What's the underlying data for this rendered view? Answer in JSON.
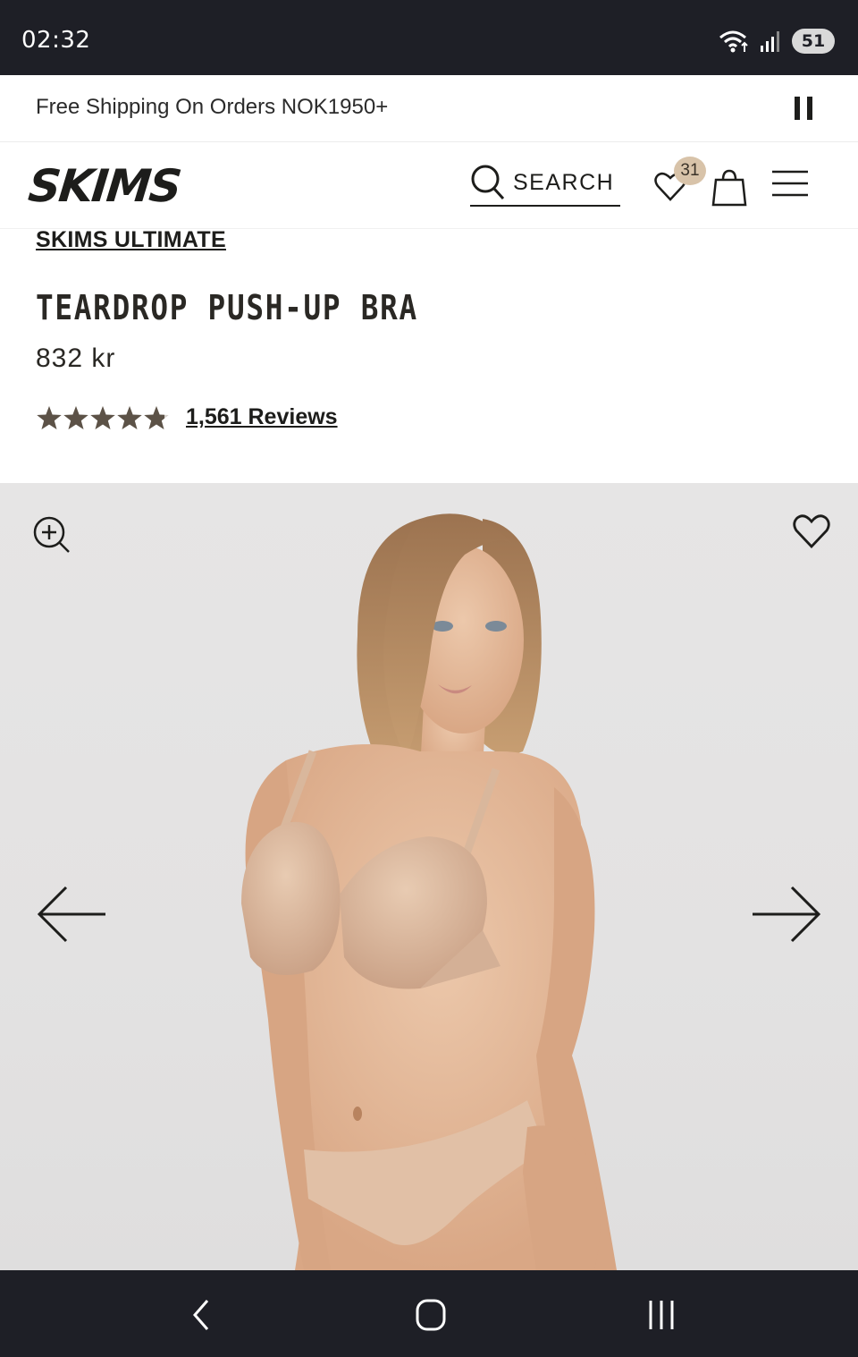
{
  "status_bar": {
    "time": "02:32",
    "battery": "51",
    "icons": [
      "wifi-icon",
      "signal-icon",
      "battery-icon"
    ]
  },
  "promo": {
    "text": "Free Shipping On Orders NOK1950+",
    "pause_icon": "pause-icon"
  },
  "header": {
    "logo": "SKIMS",
    "search_label": "SEARCH",
    "wishlist_count": "31",
    "icons": [
      "search-icon",
      "heart-icon",
      "bag-icon",
      "menu-icon"
    ]
  },
  "product": {
    "collection": "SKIMS ULTIMATE",
    "title": "TEARDROP PUSH-UP BRA",
    "price": "832 kr",
    "rating": 4.8,
    "rating_max": 5,
    "reviews_label": "1,561 Reviews"
  },
  "gallery": {
    "icons": [
      "zoom-in-icon",
      "heart-icon",
      "arrow-left-icon",
      "arrow-right-icon"
    ]
  },
  "navigation_bar": {
    "icons": [
      "back-icon",
      "home-icon",
      "recents-icon"
    ]
  },
  "colors": {
    "status_bar_bg": "#1e1f26",
    "text": "#1d1d1b",
    "star": "#5c5247",
    "badge": "#d8c3a9",
    "photo_bg": "#e4e3e3",
    "skin": "#e2b99a",
    "bra": "#d9b79c",
    "hair": "#b08660"
  }
}
